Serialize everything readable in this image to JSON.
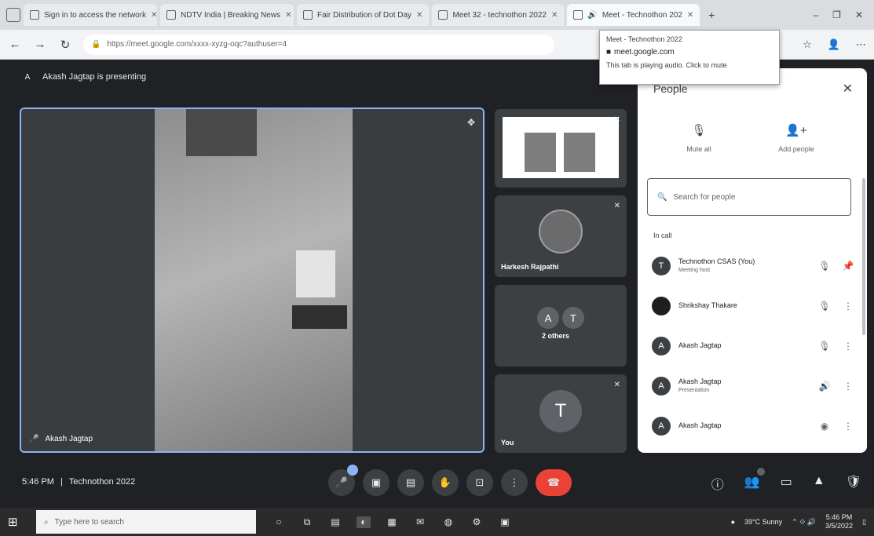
{
  "browser": {
    "tabs": [
      {
        "label": "Sign in to access the network"
      },
      {
        "label": "NDTV India | Breaking News"
      },
      {
        "label": "Fair Distribution of Dot Day"
      },
      {
        "label": "Meet 32 - technothon 2022"
      },
      {
        "label": "Meet - Technothon 202"
      }
    ],
    "new_tab": "+",
    "url": "https://meet.google.com/xxxx-xyzg-oqc?authuser=4",
    "url_host": "meet.google.com"
  },
  "tab_popup": {
    "title": "Meet - Technothon 2022",
    "site": "meet.google.com",
    "note": "This tab is playing audio. Click to mute"
  },
  "presenting": {
    "text": "Akash Jagtap is presenting"
  },
  "main_tile": {
    "name": "Akash Jagtap"
  },
  "side_tiles": {
    "participant": "Harkesh Rajpathi",
    "others_label": "2 others",
    "others_letters": [
      "A",
      "T"
    ],
    "last_letter": "T",
    "last_name": "You"
  },
  "people_panel": {
    "title": "People",
    "mute_all": "Mute all",
    "add_people": "Add people",
    "search_placeholder": "Search for people",
    "section": "In call",
    "participants": [
      {
        "initial": "T",
        "name": "Technothon CSAS (You)",
        "sub": "Meeting host"
      },
      {
        "initial": "",
        "name": "Shrikshay Thakare",
        "sub": ""
      },
      {
        "initial": "A",
        "name": "Akash Jagtap",
        "sub": ""
      },
      {
        "initial": "A",
        "name": "Akash Jagtap",
        "sub": "Presentation"
      },
      {
        "initial": "A",
        "name": "Akash Jagtap",
        "sub": ""
      }
    ]
  },
  "bottom": {
    "time": "5:46 PM",
    "separator": "|",
    "meeting": "Technothon 2022"
  },
  "taskbar": {
    "search_placeholder": "Type here to search",
    "weather": "39°C Sunny",
    "time": "5:46 PM",
    "date": "3/5/2022"
  }
}
